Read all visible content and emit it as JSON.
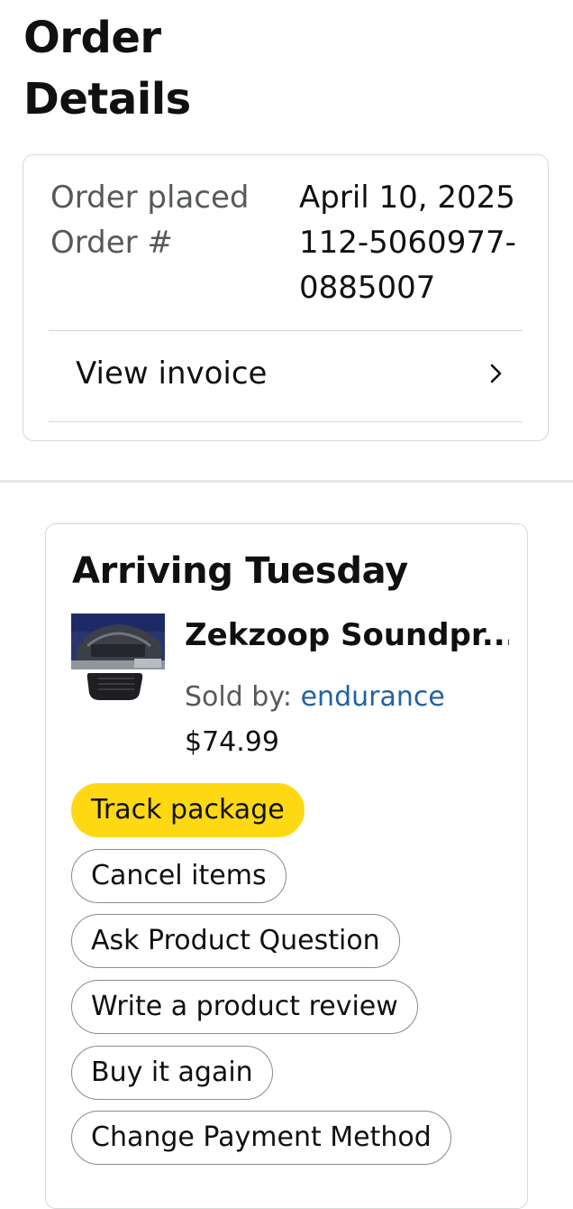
{
  "page": {
    "title": "Order Details"
  },
  "summary": {
    "order_placed_label": "Order placed",
    "order_placed_value": "April 10, 2025",
    "order_number_label": "Order #",
    "order_number_value": "112-5060977-0885007",
    "view_invoice_label": "View invoice",
    "view_invoice_icon": "chevron-right-icon"
  },
  "shipment": {
    "status_title": "Arriving Tuesday",
    "product": {
      "name": "Zekzoop Soundpr...",
      "sold_by_label": "Sold by:",
      "seller": "endurance",
      "price": "$74.99"
    },
    "actions": [
      {
        "label": "Track package"
      },
      {
        "label": "Cancel items"
      },
      {
        "label": "Ask Product Question"
      },
      {
        "label": "Write a product review"
      },
      {
        "label": "Buy it again"
      },
      {
        "label": "Change Payment Method"
      }
    ]
  },
  "colors": {
    "primary_button": "#ffd814",
    "link": "#2162a1",
    "secondary_text": "#565959",
    "border": "#d5d9d9"
  }
}
